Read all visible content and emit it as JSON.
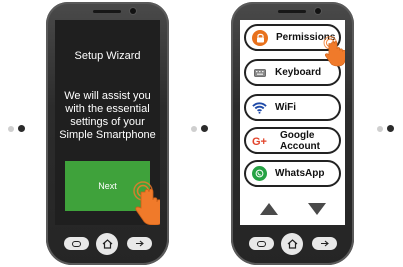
{
  "wizard": {
    "title": "Setup Wizard",
    "message": "We will assist you with the essential settings of your Simple Smartphone",
    "next_label": "Next"
  },
  "settings": {
    "items": [
      {
        "label": "Permissions",
        "icon": "lock-icon",
        "color": "#e8711c"
      },
      {
        "label": "Keyboard",
        "icon": "keyboard-icon",
        "color": "#555555"
      },
      {
        "label": "WiFi",
        "icon": "wifi-icon",
        "color": "#1f4aa8"
      },
      {
        "label": "Google Account",
        "icon": "google-plus-icon",
        "color": "#e2432a"
      },
      {
        "label": "WhatsApp",
        "icon": "whatsapp-icon",
        "color": "#25a244"
      }
    ],
    "google_line1": "Google",
    "google_line2": "Account"
  },
  "navigation": {
    "icons": [
      "back-pill-icon",
      "home-icon",
      "recent-apps-icon"
    ]
  },
  "colors": {
    "accent_orange": "#f07a2a",
    "next_green": "#3fa23b",
    "phone_body": "#2c2c2c"
  }
}
